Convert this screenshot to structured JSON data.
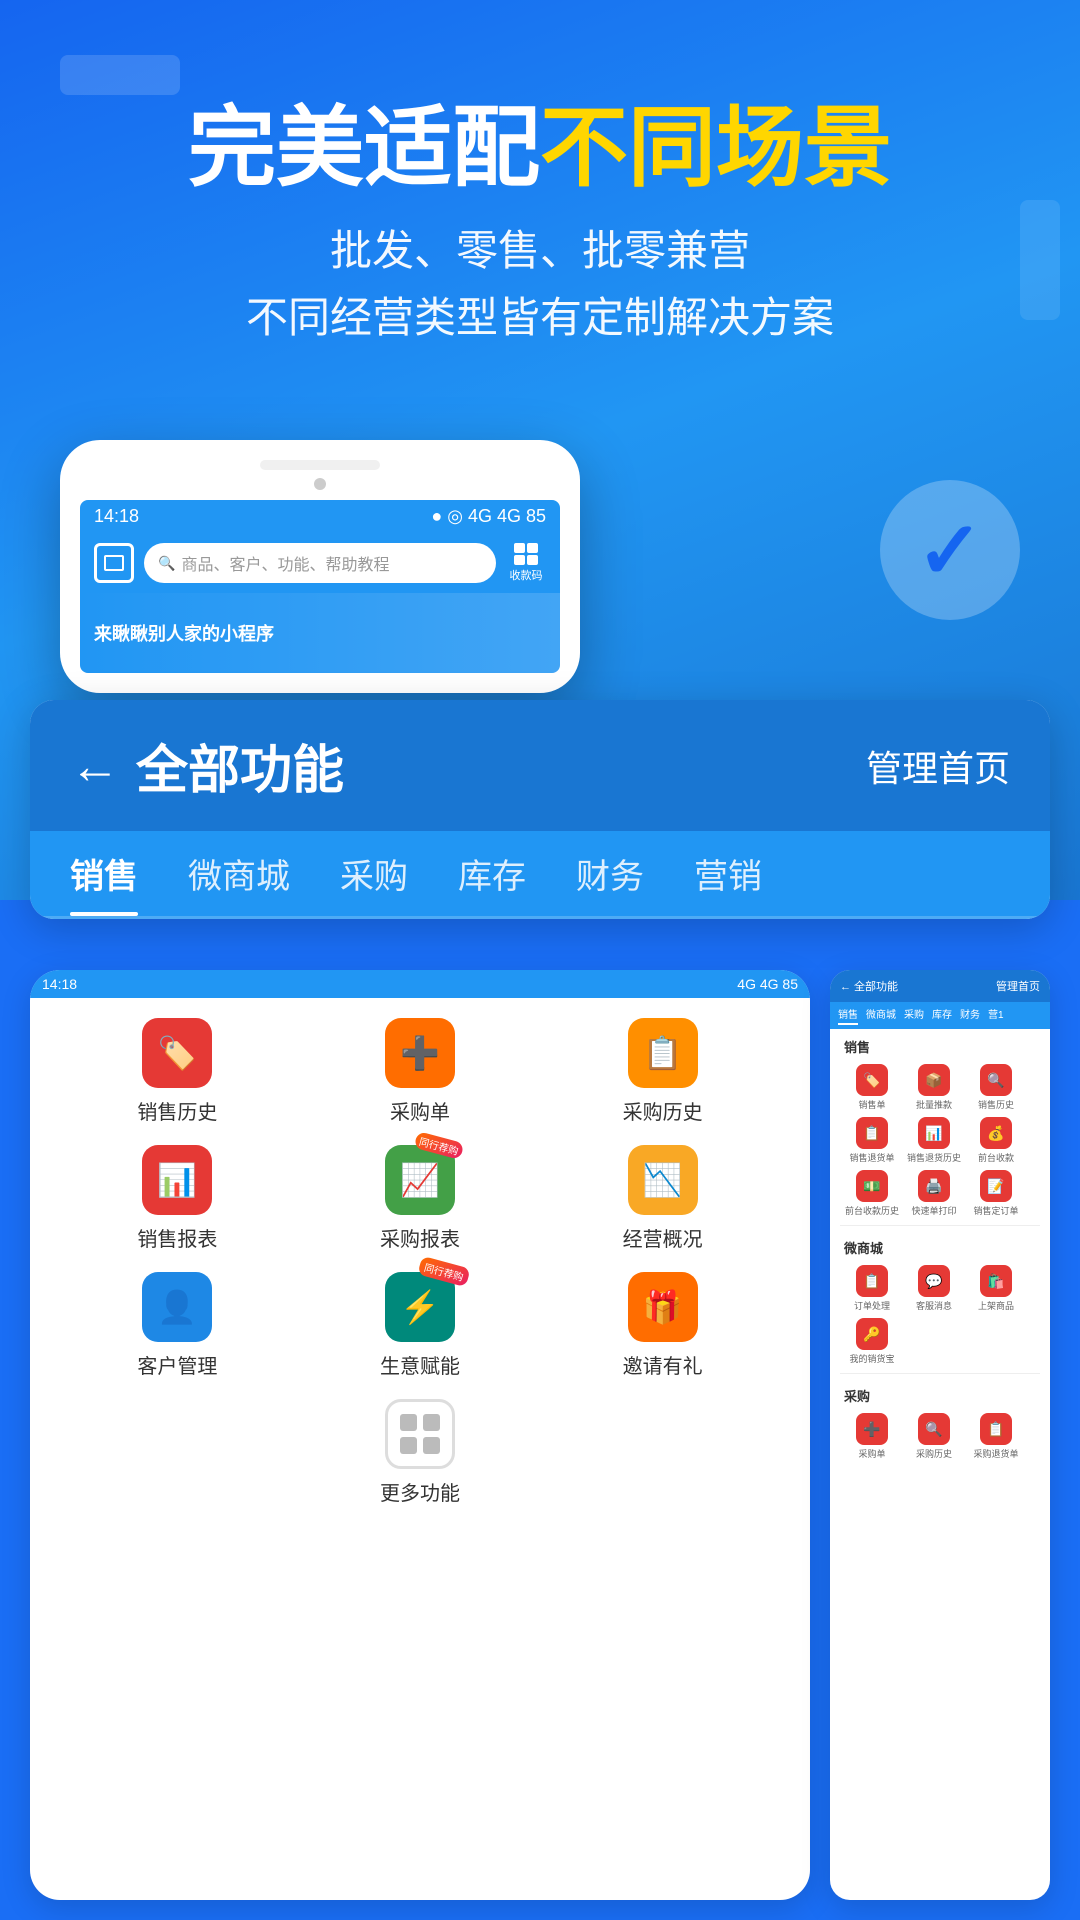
{
  "background": {
    "color_top": "#1a6ef5",
    "color_bottom": "#1a6ef5"
  },
  "hero": {
    "title_white": "完美适配",
    "title_yellow": "不同场景",
    "subtitle_line1": "批发、零售、批零兼营",
    "subtitle_line2": "不同经营类型皆有定制解决方案"
  },
  "phone_mockup": {
    "status_time": "14:18",
    "status_icons": "● ◎ 4G 4G 85",
    "search_placeholder": "商品、客户、功能、帮助教程",
    "scan_label": "扫一扫",
    "qr_label": "收款码",
    "banner_text": "来瞅瞅别人家的小程序"
  },
  "function_panel": {
    "back_label": "←",
    "title": "全部功能",
    "manage_label": "管理首页",
    "tabs": [
      {
        "label": "销售",
        "active": true
      },
      {
        "label": "微商城",
        "active": false
      },
      {
        "label": "采购",
        "active": false
      },
      {
        "label": "库存",
        "active": false
      },
      {
        "label": "财务",
        "active": false
      },
      {
        "label": "营销",
        "active": false
      }
    ]
  },
  "left_grid": {
    "rows": [
      [
        {
          "icon": "🏷️",
          "label": "销售历史",
          "color": "icon-red"
        },
        {
          "icon": "➕",
          "label": "采购单",
          "color": "icon-orange"
        },
        {
          "icon": "📋",
          "label": "采购历史",
          "color": "icon-orange2"
        }
      ],
      [
        {
          "icon": "📊",
          "label": "销售报表",
          "color": "icon-red"
        },
        {
          "icon": "📈",
          "label": "采购报表",
          "color": "icon-green",
          "badge": "同行荐购"
        },
        {
          "icon": "📉",
          "label": "经营概况",
          "color": "icon-gold"
        }
      ],
      [
        {
          "icon": "👤",
          "label": "客户管理",
          "color": "icon-blue"
        },
        {
          "icon": "⚡",
          "label": "生意赋能",
          "color": "icon-teal",
          "badge": "同行荐购"
        },
        {
          "icon": "🎁",
          "label": "邀请有礼",
          "color": "icon-orange"
        }
      ],
      [
        {
          "icon": "grid",
          "label": "更多功能",
          "color": "more"
        }
      ]
    ],
    "more_label": "更多功能"
  },
  "right_phone": {
    "header_left": "← 全部功能",
    "header_right": "管理首页",
    "tabs": [
      "销售",
      "微商城",
      "采购",
      "库存",
      "财务",
      "营1"
    ],
    "sections": [
      {
        "title": "销售",
        "items": [
          {
            "icon": "🏷️",
            "label": "销售单",
            "color": "#e53935"
          },
          {
            "icon": "📦",
            "label": "批量推款",
            "color": "#e53935"
          },
          {
            "icon": "🔍",
            "label": "销售历史",
            "color": "#e53935"
          },
          {
            "icon": "📋",
            "label": "销售退货单",
            "color": "#e53935"
          },
          {
            "icon": "📊",
            "label": "销售退货历史",
            "color": "#e53935"
          },
          {
            "icon": "💰",
            "label": "前台收款",
            "color": "#e53935"
          },
          {
            "icon": "💵",
            "label": "前台收款历史",
            "color": "#e53935"
          },
          {
            "icon": "🖨️",
            "label": "快速单打印",
            "color": "#e53935"
          },
          {
            "icon": "📝",
            "label": "销售定订单",
            "color": "#e53935"
          }
        ]
      },
      {
        "title": "微商城",
        "items": [
          {
            "icon": "📋",
            "label": "订单处理",
            "color": "#e53935"
          },
          {
            "icon": "💬",
            "label": "客服消息",
            "color": "#e53935"
          },
          {
            "icon": "🛍️",
            "label": "上架商品",
            "color": "#e53935"
          },
          {
            "icon": "🔑",
            "label": "我的销货宝",
            "color": "#e53935"
          }
        ]
      },
      {
        "title": "采购",
        "items": [
          {
            "icon": "➕",
            "label": "采购单",
            "color": "#e53935"
          },
          {
            "icon": "🔍",
            "label": "采购历史",
            "color": "#e53935"
          },
          {
            "icon": "📋",
            "label": "采购退货单",
            "color": "#e53935"
          }
        ]
      }
    ]
  }
}
